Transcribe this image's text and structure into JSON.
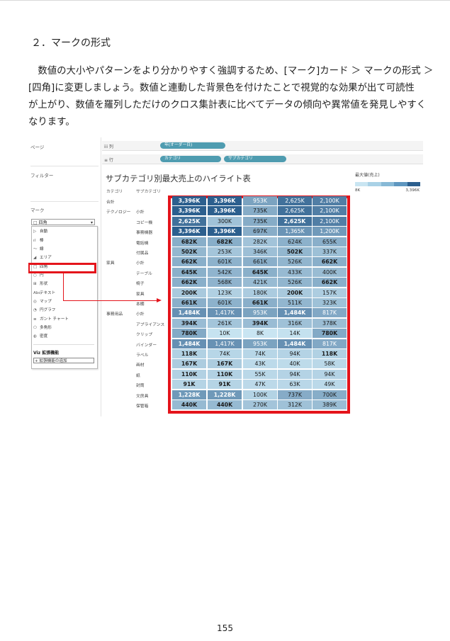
{
  "section_title": "２．マークの形式",
  "paragraph_lines": [
    "　数値の大小やパターンをより分かりやすく強調するため、[マーク]カード ＞ マークの形式 ＞",
    "[四角]に変更しましょう。数値と連動した背景色を付けたことで視覚的な効果が出て可読性",
    "が上がり、数値を羅列しただけのクロス集計表に比べてデータの傾向や異常値を発見しやすく",
    "なります。"
  ],
  "page_number": "155",
  "tableau": {
    "sidebar": {
      "pages_label": "ページ",
      "filters_label": "フィルター",
      "marks_label": "マーク",
      "marks_selected": "四角",
      "marks_menu": [
        {
          "icon": "▷",
          "label": "自動"
        },
        {
          "icon": "ıl",
          "label": "棒"
        },
        {
          "icon": "〜",
          "label": "線"
        },
        {
          "icon": "◢",
          "label": "エリア"
        },
        {
          "icon": "□",
          "label": "四角"
        },
        {
          "icon": "○",
          "label": "円"
        },
        {
          "icon": "⊞",
          "label": "形状"
        },
        {
          "icon": "Abc",
          "label": "テキスト"
        },
        {
          "icon": "◎",
          "label": "マップ"
        },
        {
          "icon": "◔",
          "label": "円グラフ"
        },
        {
          "icon": "≡",
          "label": "ガント チャート"
        },
        {
          "icon": "⬠",
          "label": "多角形"
        },
        {
          "icon": "◍",
          "label": "密度"
        }
      ],
      "extensions_heading": "Viz 拡張機能",
      "add_extension": "拡張機能の追加"
    },
    "columns_shelf": {
      "label": "iii 列",
      "pills": [
        "年(オーダー日)"
      ]
    },
    "rows_shelf": {
      "label": "≡ 行",
      "pills": [
        "カテゴリ",
        "サブカテゴリ"
      ]
    },
    "viz_title": "サブカテゴリ別最大売上のハイライト表",
    "header_category": "カテゴリ",
    "header_subcategory": "サブカテゴリ",
    "legend": {
      "title": "最大値(売上)",
      "min": "8K",
      "max": "3,396K"
    },
    "rows": [
      {
        "category": "合計",
        "sub": "",
        "values": [
          "3,396K",
          "3,396K",
          "953K",
          "2,625K",
          "2,100K"
        ]
      },
      {
        "category": "テクノロジー",
        "sub": "小計",
        "values": [
          "3,396K",
          "3,396K",
          "735K",
          "2,625K",
          "2,100K"
        ]
      },
      {
        "category": "",
        "sub": "コピー機",
        "values": [
          "2,625K",
          "300K",
          "735K",
          "2,625K",
          "2,100K"
        ]
      },
      {
        "category": "",
        "sub": "事務機器",
        "values": [
          "3,396K",
          "3,396K",
          "697K",
          "1,365K",
          "1,200K"
        ]
      },
      {
        "category": "",
        "sub": "電話機",
        "values": [
          "682K",
          "682K",
          "282K",
          "624K",
          "655K"
        ]
      },
      {
        "category": "",
        "sub": "付属品",
        "values": [
          "502K",
          "253K",
          "346K",
          "502K",
          "337K"
        ]
      },
      {
        "category": "家具",
        "sub": "小計",
        "values": [
          "662K",
          "601K",
          "661K",
          "526K",
          "662K"
        ]
      },
      {
        "category": "",
        "sub": "テーブル",
        "values": [
          "645K",
          "542K",
          "645K",
          "433K",
          "400K"
        ]
      },
      {
        "category": "",
        "sub": "椅子",
        "values": [
          "662K",
          "568K",
          "421K",
          "526K",
          "662K"
        ]
      },
      {
        "category": "",
        "sub": "家具",
        "values": [
          "200K",
          "123K",
          "180K",
          "200K",
          "157K"
        ]
      },
      {
        "category": "",
        "sub": "本棚",
        "values": [
          "661K",
          "601K",
          "661K",
          "511K",
          "323K"
        ]
      },
      {
        "category": "事務用品",
        "sub": "小計",
        "values": [
          "1,484K",
          "1,417K",
          "953K",
          "1,484K",
          "817K"
        ]
      },
      {
        "category": "",
        "sub": "アプライアンス",
        "values": [
          "394K",
          "261K",
          "394K",
          "316K",
          "378K"
        ]
      },
      {
        "category": "",
        "sub": "クリップ",
        "values": [
          "780K",
          "10K",
          "8K",
          "14K",
          "780K"
        ]
      },
      {
        "category": "",
        "sub": "バインダー",
        "values": [
          "1,484K",
          "1,417K",
          "953K",
          "1,484K",
          "817K"
        ]
      },
      {
        "category": "",
        "sub": "ラベル",
        "values": [
          "118K",
          "74K",
          "74K",
          "94K",
          "118K"
        ]
      },
      {
        "category": "",
        "sub": "画材",
        "values": [
          "167K",
          "167K",
          "43K",
          "40K",
          "58K"
        ]
      },
      {
        "category": "",
        "sub": "紙",
        "values": [
          "110K",
          "110K",
          "55K",
          "94K",
          "94K"
        ]
      },
      {
        "category": "",
        "sub": "封筒",
        "values": [
          "91K",
          "91K",
          "47K",
          "63K",
          "49K"
        ]
      },
      {
        "category": "",
        "sub": "文房具",
        "values": [
          "1,228K",
          "1,228K",
          "100K",
          "737K",
          "700K"
        ]
      },
      {
        "category": "",
        "sub": "保管箱",
        "values": [
          "440K",
          "440K",
          "270K",
          "312K",
          "389K"
        ]
      }
    ],
    "colors": {
      "highlight_red": "#e4141b",
      "pill": "#4f9cb0",
      "dark_cell": "#2c5f8e",
      "light_cell": "#c9e5f2"
    }
  }
}
